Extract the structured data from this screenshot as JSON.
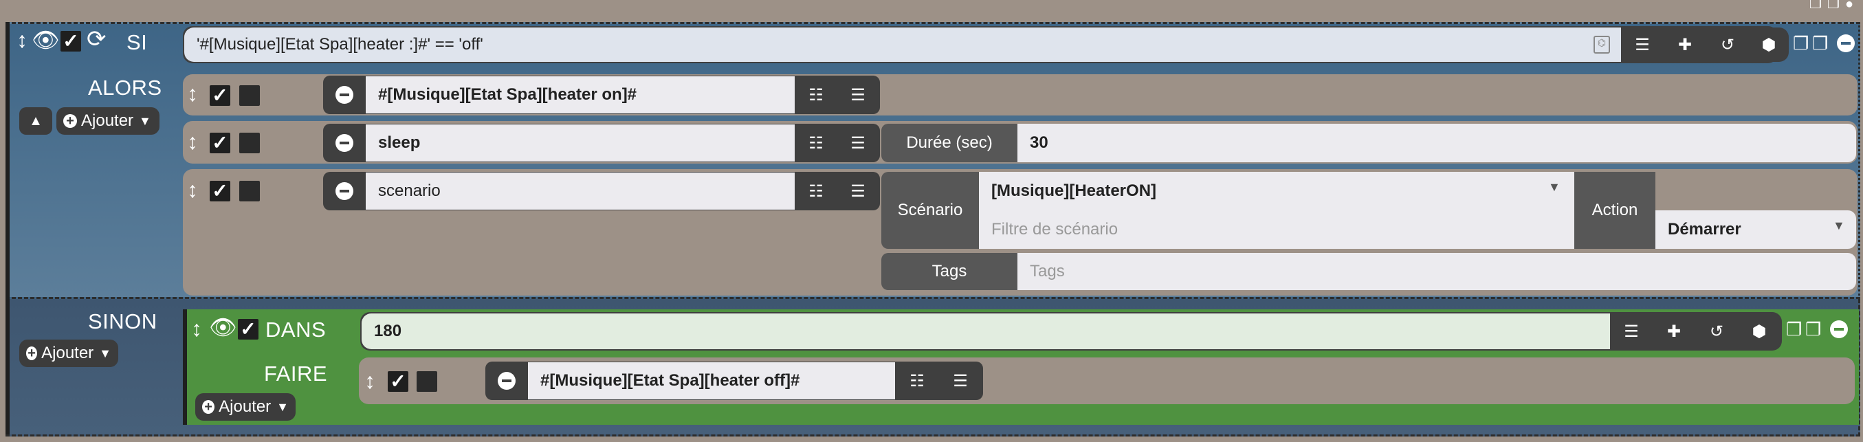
{
  "si": {
    "label": "SI",
    "condition": "'#[Musique][Etat Spa][heater :]#' == 'off'"
  },
  "alors": {
    "label": "ALORS",
    "ajouter": "Ajouter",
    "actions": [
      {
        "command": "#[Musique][Etat Spa][heater on]#"
      },
      {
        "command": "sleep",
        "duration_label": "Durée (sec)",
        "duration_value": "30"
      },
      {
        "command": "scenario",
        "scenario_label": "Scénario",
        "scenario_value": "[Musique][HeaterON]",
        "scenario_filter_placeholder": "Filtre de scénario",
        "action_label": "Action",
        "action_value": "Démarrer",
        "tags_label": "Tags",
        "tags_placeholder": "Tags"
      }
    ]
  },
  "sinon": {
    "label": "SINON",
    "ajouter": "Ajouter",
    "dans": {
      "label": "DANS",
      "value": "180",
      "faire_label": "FAIRE",
      "ajouter": "Ajouter",
      "action": "#[Musique][Etat Spa][heater off]#"
    }
  },
  "colors": {
    "si_block": "#3e6586",
    "dans_block": "#4f9240",
    "row_bg": "#9d9187",
    "dark": "#3f3f3f"
  }
}
